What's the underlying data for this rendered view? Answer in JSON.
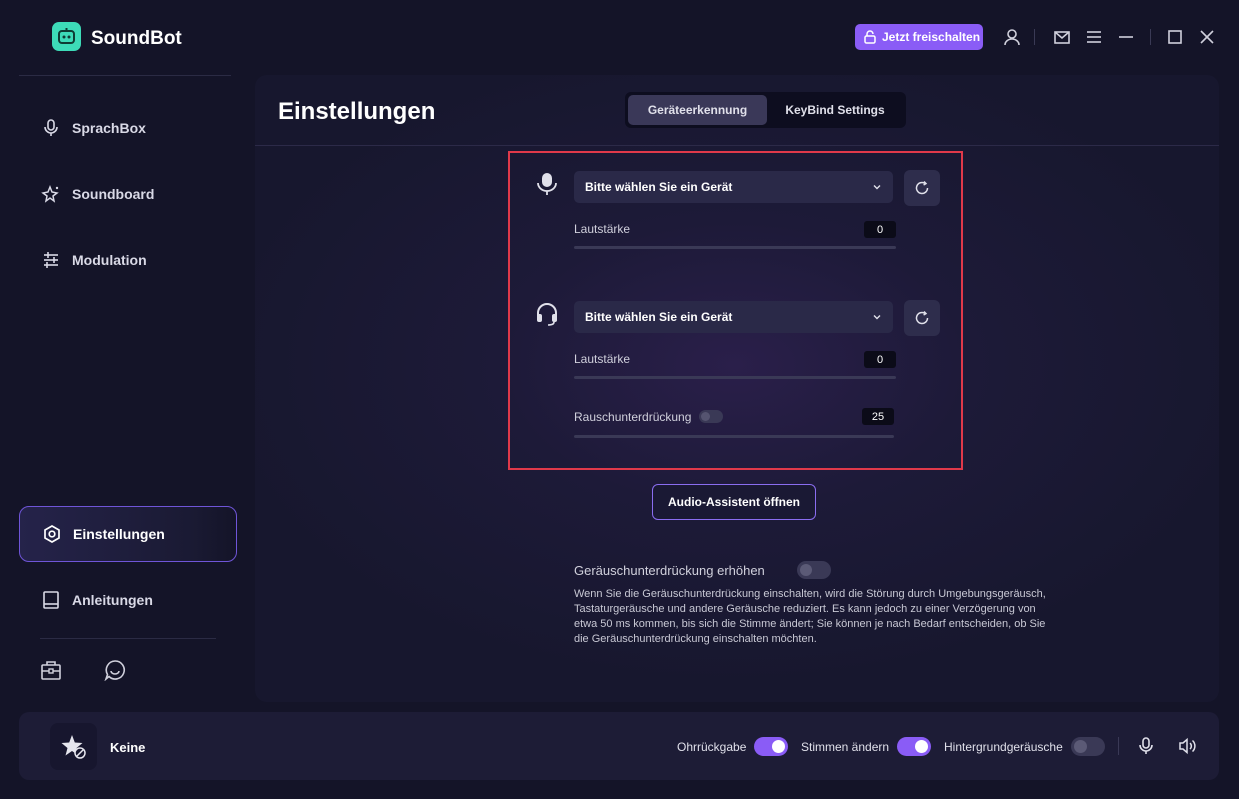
{
  "app": {
    "title": "SoundBot",
    "unlock_label": "Jetzt freischalten"
  },
  "colors": {
    "accent": "#8a5cf6",
    "highlight": "#e0394a",
    "logo": "#3ddbb8",
    "background": "#141428"
  },
  "sidebar": {
    "items": [
      {
        "label": "SprachBox",
        "icon": "microphone-icon"
      },
      {
        "label": "Soundboard",
        "icon": "sparkle-star-icon"
      },
      {
        "label": "Modulation",
        "icon": "sliders-icon"
      },
      {
        "label": "Einstellungen",
        "icon": "settings-hexagon-icon",
        "active": true
      },
      {
        "label": "Anleitungen",
        "icon": "book-icon"
      }
    ],
    "bottom_icons": [
      "toolbox-icon",
      "chat-bubble-icon"
    ]
  },
  "settings": {
    "title": "Einstellungen",
    "tabs": [
      {
        "label": "Geräteerkennung",
        "active": true
      },
      {
        "label": "KeyBind Settings",
        "active": false
      }
    ],
    "input_device": {
      "placeholder": "Bitte wählen Sie ein Gerät",
      "volume_label": "Lautstärke",
      "volume_value": "0"
    },
    "output_device": {
      "placeholder": "Bitte wählen Sie ein Gerät",
      "volume_label": "Lautstärke",
      "volume_value": "0",
      "noise_label": "Rauschunterdrückung",
      "noise_value": "25",
      "noise_enabled": false
    },
    "assistant_button": "Audio-Assistent öffnen",
    "noise_boost": {
      "label": "Geräuschunterdrückung erhöhen",
      "enabled": false,
      "description": "Wenn Sie die Geräuschunterdrückung einschalten, wird die Störung durch Umgebungsgeräusch, Tastaturgeräusche und andere Geräusche reduziert. Es kann jedoch zu einer Verzögerung von etwa 50 ms kommen, bis sich die Stimme ändert; Sie können je nach Bedarf entscheiden, ob Sie die Geräuschunterdrückung einschalten möchten."
    }
  },
  "bottombar": {
    "current_voice": "Keine",
    "toggles": [
      {
        "label": "Ohrrückgabe",
        "on": true
      },
      {
        "label": "Stimmen ändern",
        "on": true
      },
      {
        "label": "Hintergrundgeräusche",
        "on": false
      }
    ]
  }
}
